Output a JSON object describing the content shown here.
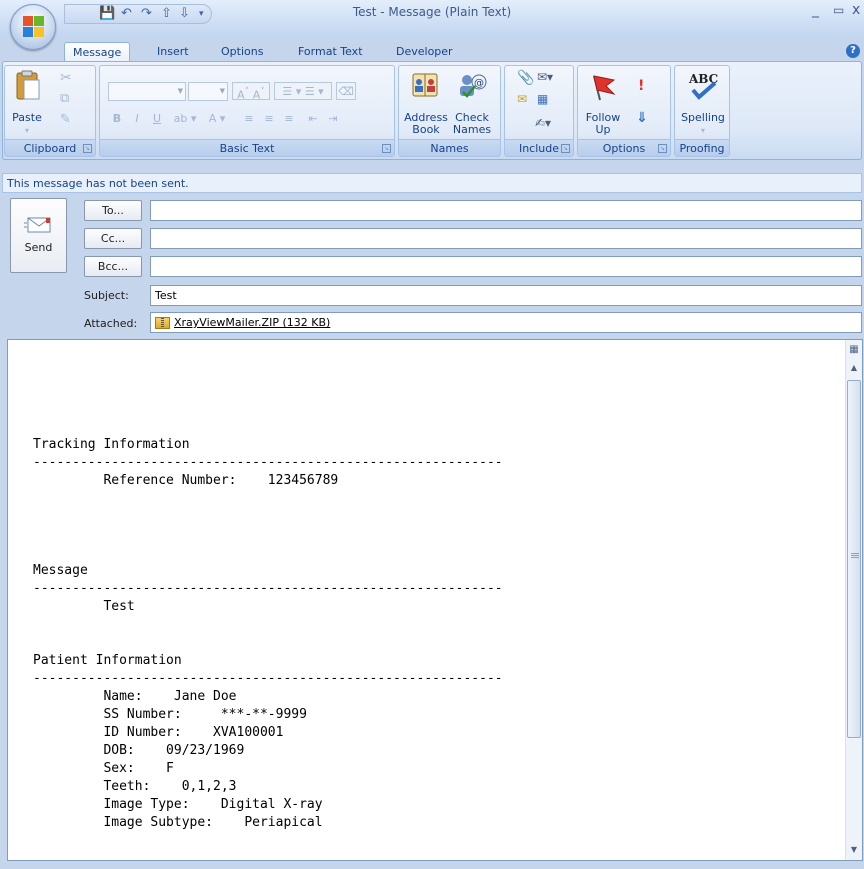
{
  "window": {
    "title": "Test - Message (Plain Text)",
    "minimize": "_",
    "maximize": "▭",
    "close": "x"
  },
  "tabs": [
    {
      "label": "Message",
      "active": true
    },
    {
      "label": "Insert"
    },
    {
      "label": "Options"
    },
    {
      "label": "Format Text"
    },
    {
      "label": "Developer"
    }
  ],
  "ribbon": {
    "clipboard": {
      "label": "Clipboard",
      "paste": "Paste"
    },
    "basic_text": {
      "label": "Basic Text"
    },
    "names": {
      "label": "Names",
      "address_book": "Address\nBook",
      "check_names": "Check\nNames"
    },
    "include": {
      "label": "Include"
    },
    "options": {
      "label": "Options",
      "follow_up": "Follow\nUp"
    },
    "proofing": {
      "label": "Proofing",
      "spelling": "Spelling"
    }
  },
  "infobar": {
    "text": "This message has not been sent."
  },
  "send": {
    "label": "Send"
  },
  "address": {
    "to_button": "To...",
    "cc_button": "Cc...",
    "bcc_button": "Bcc...",
    "to_value": "",
    "cc_value": "",
    "bcc_value": ""
  },
  "subject": {
    "label": "Subject:",
    "value": "Test"
  },
  "attached": {
    "label": "Attached:",
    "file": "XrayViewMailer.ZIP (132 KB)"
  },
  "body": {
    "text": "Tracking Information\n------------------------------------------------------------\n         Reference Number:    123456789\n\n\n\n\nMessage\n------------------------------------------------------------\n         Test\n\n\nPatient Information\n------------------------------------------------------------\n         Name:    Jane Doe\n         SS Number:     ***-**-9999\n         ID Number:    XVA100001\n         DOB:    09/23/1969\n         Sex:    F\n         Teeth:    0,1,2,3\n         Image Type:    Digital X-ray\n         Image Subtype:    Periapical"
  },
  "colors": {
    "accent": "#15428b",
    "ribbon_border": "#8db2e3",
    "follow_up_flag": "#e0322a"
  }
}
